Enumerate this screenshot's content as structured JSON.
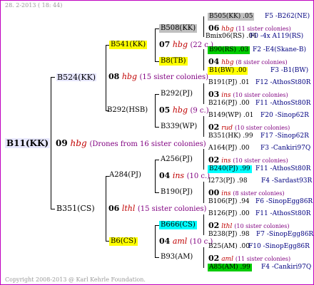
{
  "header": {
    "date_text": "28.  2-2013 ( 18: 44)"
  },
  "footer": {
    "copyright": "Copyright 2008-2013 @ Karl Kehrle Foundation."
  },
  "colors": {
    "frame": "#c000c0",
    "yellow": "#ffff00",
    "grey": "#c0c0c0",
    "cyan": "#00ffff",
    "green": "#00cc00",
    "lavender": "#e8e8ff"
  },
  "root": {
    "label": "B11(KK)",
    "num": "09",
    "code": "hbg",
    "note": "(Drones from 16 sister colonies)"
  },
  "g1": [
    {
      "label": "B524(KK)",
      "num": "08",
      "code": "hbg",
      "note": "(15 sister colonies)"
    },
    {
      "label": "B351(CS)",
      "num": "06",
      "code": "lthl",
      "note": "(15 sister colonies)"
    }
  ],
  "g2": [
    {
      "label": "B541(KK)",
      "num": "07",
      "code": "hbg",
      "note": "(22 c.)"
    },
    {
      "label": "B292(HSB)",
      "num": "05",
      "code": "hbg",
      "note": "(9 c.)"
    },
    {
      "label": "A284(PJ)",
      "num": "04",
      "code": "ins",
      "note": "(10 c.)"
    },
    {
      "label": "B6(CS)",
      "num": "04",
      "code": "aml",
      "note": "(10 c.)"
    }
  ],
  "g3": [
    {
      "label": "B508(KK)",
      "num": "06",
      "code": "hbg",
      "note": "(11 sister colonies)"
    },
    {
      "label": "B8(TB)",
      "num": "04",
      "code": "hbg",
      "note": "(8 sister colonies)"
    },
    {
      "label": "B292(PJ)",
      "num": "03",
      "code": "ins",
      "note": "(10 sister colonies)"
    },
    {
      "label": "B339(WP)",
      "num": "02",
      "code": "rud",
      "note": "(10 sister colonies)"
    },
    {
      "label": "A256(PJ)",
      "num": "02",
      "code": "ins",
      "note": "(10 sister colonies)"
    },
    {
      "label": "B190(PJ)",
      "num": "00",
      "code": "ins",
      "note": "(8 sister colonies)"
    },
    {
      "label": "B666(CS)",
      "num": "02",
      "code": "lthl",
      "note": "(10 sister colonies)"
    },
    {
      "label": "B93(AM)",
      "num": "02",
      "code": "aml",
      "note": "(11 sister colonies)"
    }
  ],
  "g4": [
    {
      "label": "B505(KK) .05",
      "right": "F5 -B262(NE)"
    },
    {
      "label": "Bmix06(RS) .04",
      "right": "F0 -4x A119(RS)"
    },
    {
      "label": "B90(RS) .03",
      "right": "F2 -E4(Skane-B)"
    },
    {
      "label": "B1(BW) .00",
      "right": "F3 -B1(BW)"
    },
    {
      "label": "B191(PJ) .01",
      "right": "F12 -AthosSt80R"
    },
    {
      "label": "B216(PJ) .00",
      "right": "F11 -AthosSt80R"
    },
    {
      "label": "B149(WP) .01",
      "right": "F20 -Sinop62R"
    },
    {
      "label": "B351(HK) .99",
      "right": "F17 -Sinop62R"
    },
    {
      "label": "A164(PJ) .00",
      "right": "F3 -Cankiri97Q"
    },
    {
      "label": "B240(PJ) .99",
      "right": "F11 -AthosSt80R"
    },
    {
      "label": "I273(PJ) .98",
      "right": "F4 -Sardast93R"
    },
    {
      "label": "B106(PJ) .94",
      "right": "F6 -SinopEgg86R"
    },
    {
      "label": "B126(PJ) .00",
      "right": "F11 -AthosSt80R"
    },
    {
      "label": "B238(PJ) .98",
      "right": "F7 -SinopEgg86R"
    },
    {
      "label": "B25(AM) .00",
      "right": "F10 -SinopEgg86R"
    },
    {
      "label": "A85(AM) .99",
      "right": "F4 -Cankiri97Q"
    }
  ]
}
